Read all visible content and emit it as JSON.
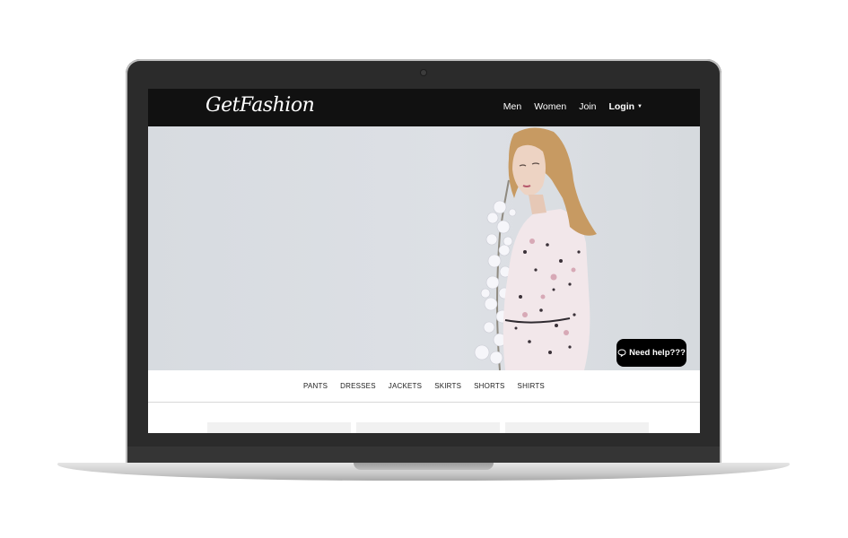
{
  "brand": {
    "name": "GetFashion"
  },
  "nav": {
    "items": [
      {
        "label": "Men"
      },
      {
        "label": "Women"
      },
      {
        "label": "Join"
      }
    ],
    "login_label": "Login"
  },
  "chat": {
    "label": "Need help???",
    "icon": "speech-bubble-icon"
  },
  "categories": [
    {
      "label": "PANTS"
    },
    {
      "label": "DRESSES"
    },
    {
      "label": "JACKETS"
    },
    {
      "label": "SKIRTS"
    },
    {
      "label": "SHORTS"
    },
    {
      "label": "SHIRTS"
    }
  ],
  "colors": {
    "navbar": "#111111",
    "hero_background": "#dde0e5",
    "chat_button": "#000000"
  }
}
